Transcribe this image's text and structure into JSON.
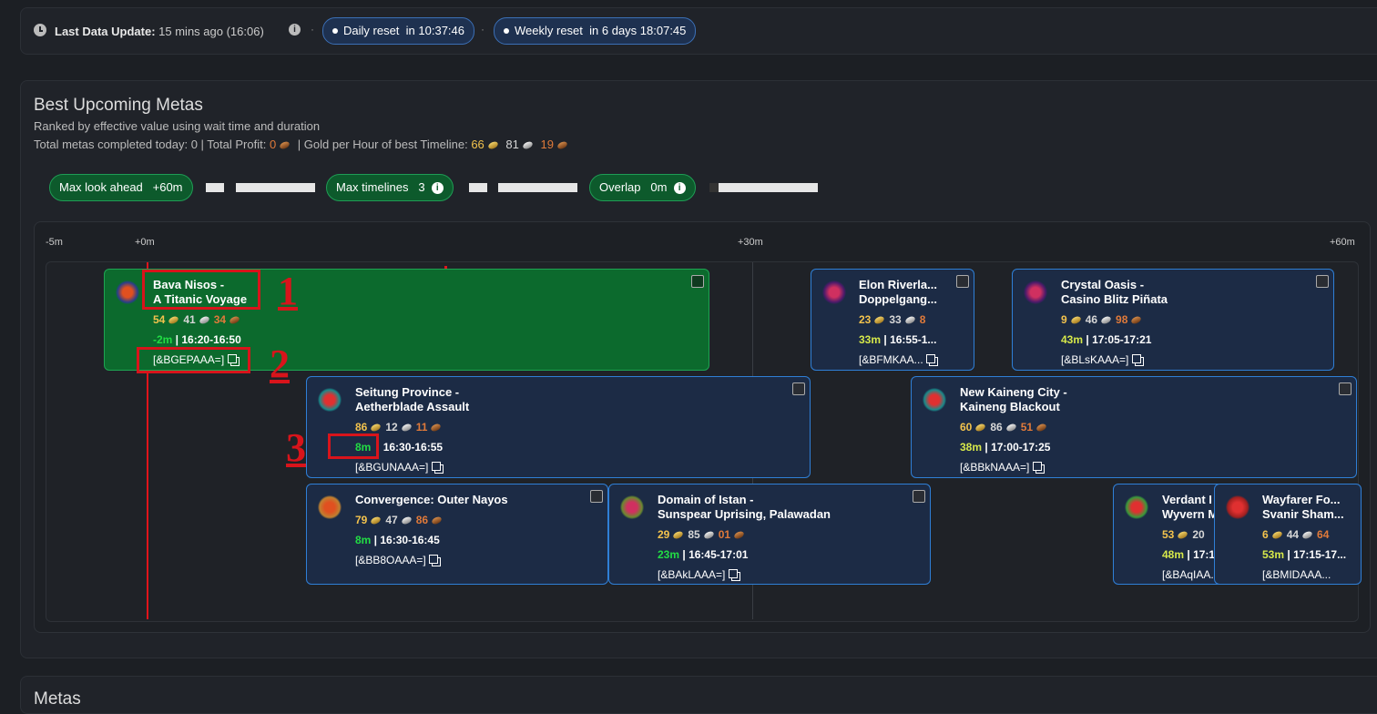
{
  "status_bar": {
    "last_update_label": "Last Data Update:",
    "last_update_value": "15 mins ago (16:06)",
    "daily_reset_label": "Daily reset",
    "daily_reset_value": "in 10:37:46",
    "weekly_reset_label": "Weekly reset",
    "weekly_reset_value": "in 6 days 18:07:45"
  },
  "section": {
    "title": "Best Upcoming Metas",
    "subtitle": "Ranked by effective value using wait time and duration",
    "stats_prefix": "Total metas completed today: 0 | Total Profit: ",
    "profit_copper": "0",
    "gph_label": " | Gold per Hour of best Timeline: ",
    "gph_gold": "66",
    "gph_silver": "81",
    "gph_copper": "19"
  },
  "controls": {
    "look_ahead_label": "Max look ahead",
    "look_ahead_value": "+60m",
    "timelines_label": "Max timelines",
    "timelines_value": "3",
    "overlap_label": "Overlap",
    "overlap_value": "0m"
  },
  "timeline": {
    "ticks": [
      "-5m",
      "+0m",
      "+30m",
      "+60m"
    ]
  },
  "cards": [
    {
      "title1": "Bava Nisos -",
      "title2": "A Titanic Voyage",
      "gold": "54",
      "silver": "41",
      "copper": "34",
      "wait": "-2m",
      "time": "16:20-16:50",
      "code": "[&BGEPAAA=]"
    },
    {
      "title1": "Elon Riverla...",
      "title2": "Doppelgang...",
      "gold": "23",
      "silver": "33",
      "copper": "8",
      "wait": "33m",
      "time": "16:55-1...",
      "code": "[&BFMKAA..."
    },
    {
      "title1": "Crystal Oasis -",
      "title2": "Casino Blitz Piñata",
      "gold": "9",
      "silver": "46",
      "copper": "98",
      "wait": "43m",
      "time": "17:05-17:21",
      "code": "[&BLsKAAA=]"
    },
    {
      "title1": "Seitung Province -",
      "title2": "Aetherblade Assault",
      "gold": "86",
      "silver": "12",
      "copper": "11",
      "wait": "8m",
      "time": "16:30-16:55",
      "code": "[&BGUNAAA=]"
    },
    {
      "title1": "New Kaineng City -",
      "title2": "Kaineng Blackout",
      "gold": "60",
      "silver": "86",
      "copper": "51",
      "wait": "38m",
      "time": "17:00-17:25",
      "code": "[&BBkNAAA=]"
    },
    {
      "title1": "Convergence: Outer Nayos",
      "title2": "",
      "gold": "79",
      "silver": "47",
      "copper": "86",
      "wait": "8m",
      "time": "16:30-16:45",
      "code": "[&BB8OAAA=]"
    },
    {
      "title1": "Domain of Istan -",
      "title2": "Sunspear Uprising, Palawadan",
      "gold": "29",
      "silver": "85",
      "copper": "01",
      "wait": "23m",
      "time": "16:45-17:01",
      "code": "[&BAkLAAA=]"
    },
    {
      "title1": "Verdant I",
      "title2": "Wyvern M",
      "gold": "53",
      "silver": "20",
      "copper": "",
      "wait": "48m",
      "time": "17:1...",
      "code": "[&BAqIAA..."
    },
    {
      "title1": "Wayfarer Fo...",
      "title2": "Svanir Sham...",
      "gold": "6",
      "silver": "44",
      "copper": "64",
      "wait": "53m",
      "time": "17:15-17...",
      "code": "[&BMIDAAA..."
    }
  ],
  "annotations": [
    "1",
    "2",
    "3"
  ],
  "next_section_title": "Metas",
  "colors": {
    "accent_green": "#0c6a2d",
    "card_blue": "#1c2b45",
    "now_line": "#e0141b",
    "gold": "#f3c34d",
    "copper": "#e07a3a"
  }
}
